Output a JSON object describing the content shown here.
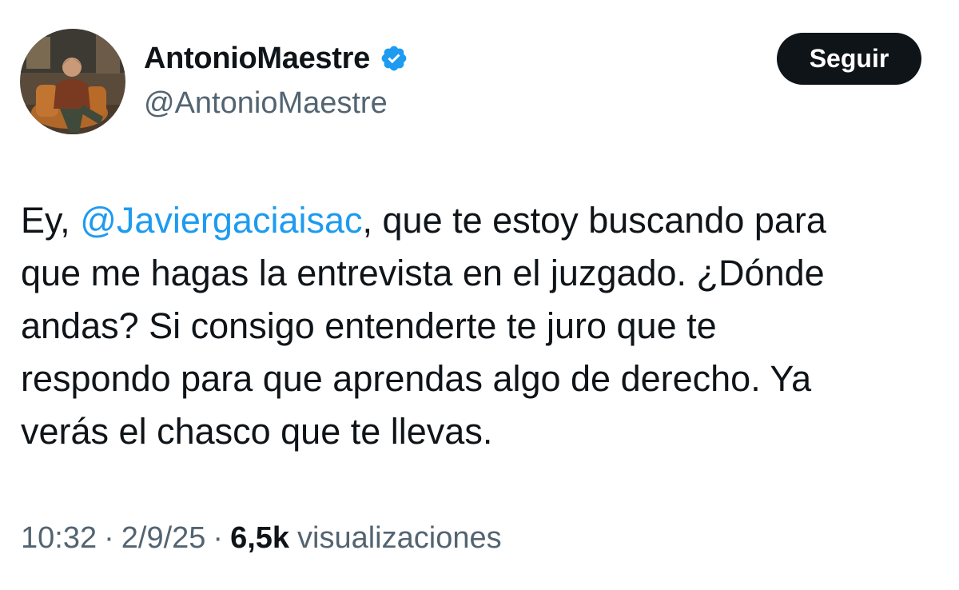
{
  "author": {
    "display_name": "AntonioMaestre",
    "handle": "@AntonioMaestre",
    "verified": true
  },
  "follow_button_label": "Seguir",
  "tweet": {
    "line1_before": "Ey, ",
    "mention": "@Javiergaciaisac",
    "line1_after": ", que te estoy buscando para",
    "line2": "que me hagas la entrevista en el juzgado. ¿Dónde",
    "line3": "andas? Si consigo entenderte te juro que te",
    "line4": "respondo para que aprendas algo de derecho. Ya",
    "line5": "verás el chasco que te llevas."
  },
  "meta": {
    "time": "10:32",
    "separator": "·",
    "date": "2/9/25",
    "views_count": "6,5k",
    "views_label": "visualizaciones"
  },
  "colors": {
    "accent": "#1d9bf0",
    "text": "#0f1419",
    "secondary": "#536471",
    "button_bg": "#0f1419"
  }
}
